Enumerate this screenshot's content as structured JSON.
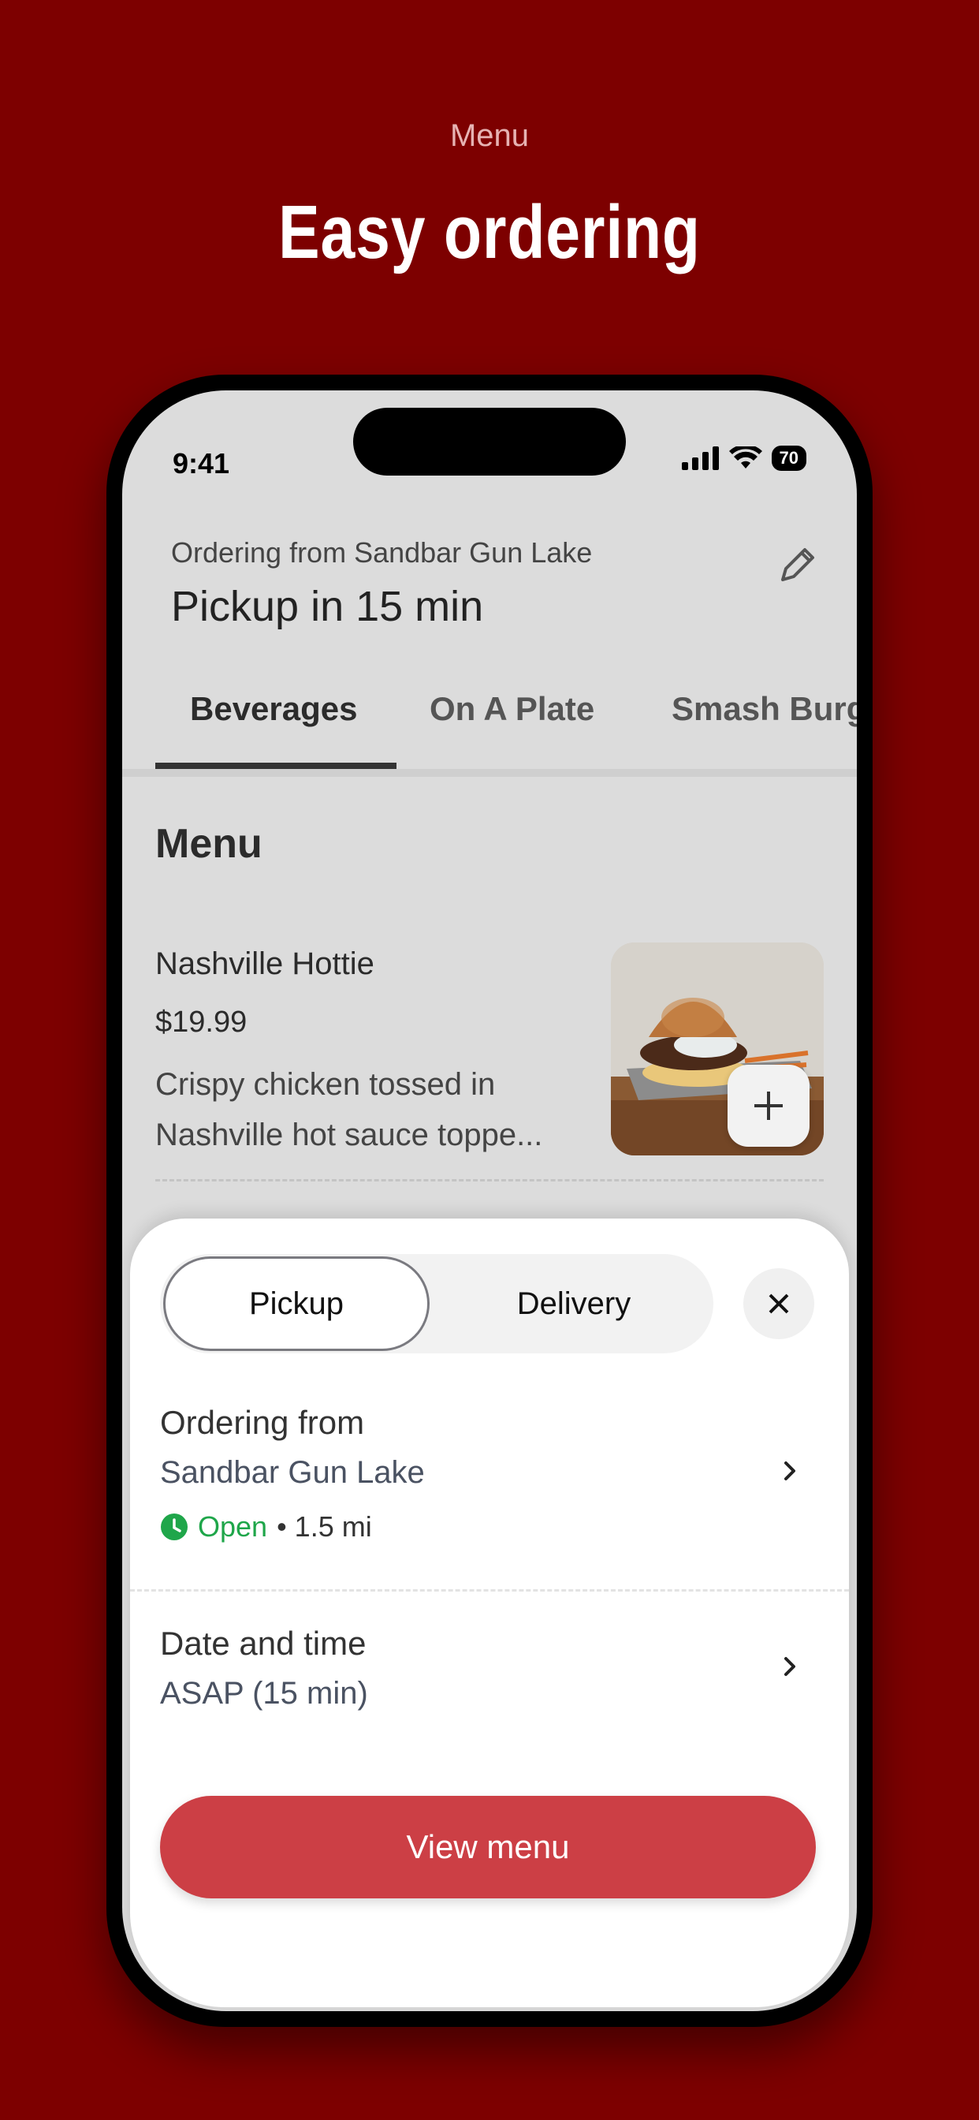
{
  "promo": {
    "subtitle": "Menu",
    "title": "Easy ordering"
  },
  "status_bar": {
    "time": "9:41",
    "battery": "70"
  },
  "header": {
    "ordering_from": "Ordering from Sandbar Gun Lake",
    "pickup_time": "Pickup in 15 min",
    "edit_icon": "pencil-icon"
  },
  "tabs": [
    {
      "label": "Beverages",
      "active": true
    },
    {
      "label": "On A Plate",
      "active": false
    },
    {
      "label": "Smash Burg",
      "active": false
    }
  ],
  "menu": {
    "heading": "Menu",
    "items": [
      {
        "name": "Nashville Hottie",
        "price": "$19.99",
        "description": "Crispy chicken tossed in Nashville hot sauce toppe...",
        "add_icon": "plus-icon"
      }
    ]
  },
  "sheet": {
    "segments": {
      "pickup": "Pickup",
      "delivery": "Delivery",
      "selected": "Pickup"
    },
    "close_icon": "close-icon",
    "ordering_from_label": "Ordering from",
    "store_name": "Sandbar Gun Lake",
    "status": "Open",
    "distance": "• 1.5 mi",
    "date_time_label": "Date and time",
    "date_time_value": "ASAP (15 min)",
    "cta": "View menu"
  },
  "colors": {
    "background": "#7d0000",
    "cta": "#cc3f45",
    "open": "#1fa64a"
  }
}
